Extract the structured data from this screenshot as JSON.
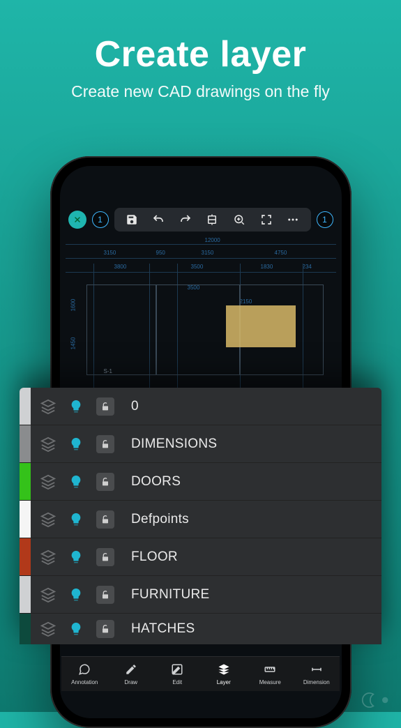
{
  "hero": {
    "title": "Create layer",
    "subtitle": "Create new CAD drawings on the fly"
  },
  "toolbar": {
    "close_icon": "close",
    "badge1": "1",
    "badge2": "1",
    "icons": [
      "save",
      "undo",
      "redo",
      "snap",
      "zoom",
      "fullscreen",
      "more"
    ]
  },
  "blueprint": {
    "dims_top": [
      "3150",
      "950",
      "3150",
      "4750"
    ],
    "dim_overall": "12000",
    "dims_row2": [
      "3800",
      "3500",
      "1830",
      "234"
    ],
    "dims_row3": [
      "3500",
      "2150"
    ],
    "left_dims": [
      "1600",
      "1450"
    ],
    "room_label": "S-1"
  },
  "layers": [
    {
      "color": "#cfd1d3",
      "name": "0"
    },
    {
      "color": "#8a8c8e",
      "name": "DIMENSIONS"
    },
    {
      "color": "#34c21a",
      "name": "DOORS"
    },
    {
      "color": "#f5f5f5",
      "name": "Defpoints"
    },
    {
      "color": "#b1391a",
      "name": "FLOOR"
    },
    {
      "color": "#cfd1d3",
      "name": "FURNITURE"
    },
    {
      "color": "#0d4a3d",
      "name": "HATCHES"
    }
  ],
  "bottom_nav": [
    {
      "label": "Annotation",
      "icon": "annotation"
    },
    {
      "label": "Draw",
      "icon": "draw"
    },
    {
      "label": "Edit",
      "icon": "edit"
    },
    {
      "label": "Layer",
      "icon": "layer",
      "active": true
    },
    {
      "label": "Measure",
      "icon": "measure"
    },
    {
      "label": "Dimension",
      "icon": "dimension"
    }
  ]
}
